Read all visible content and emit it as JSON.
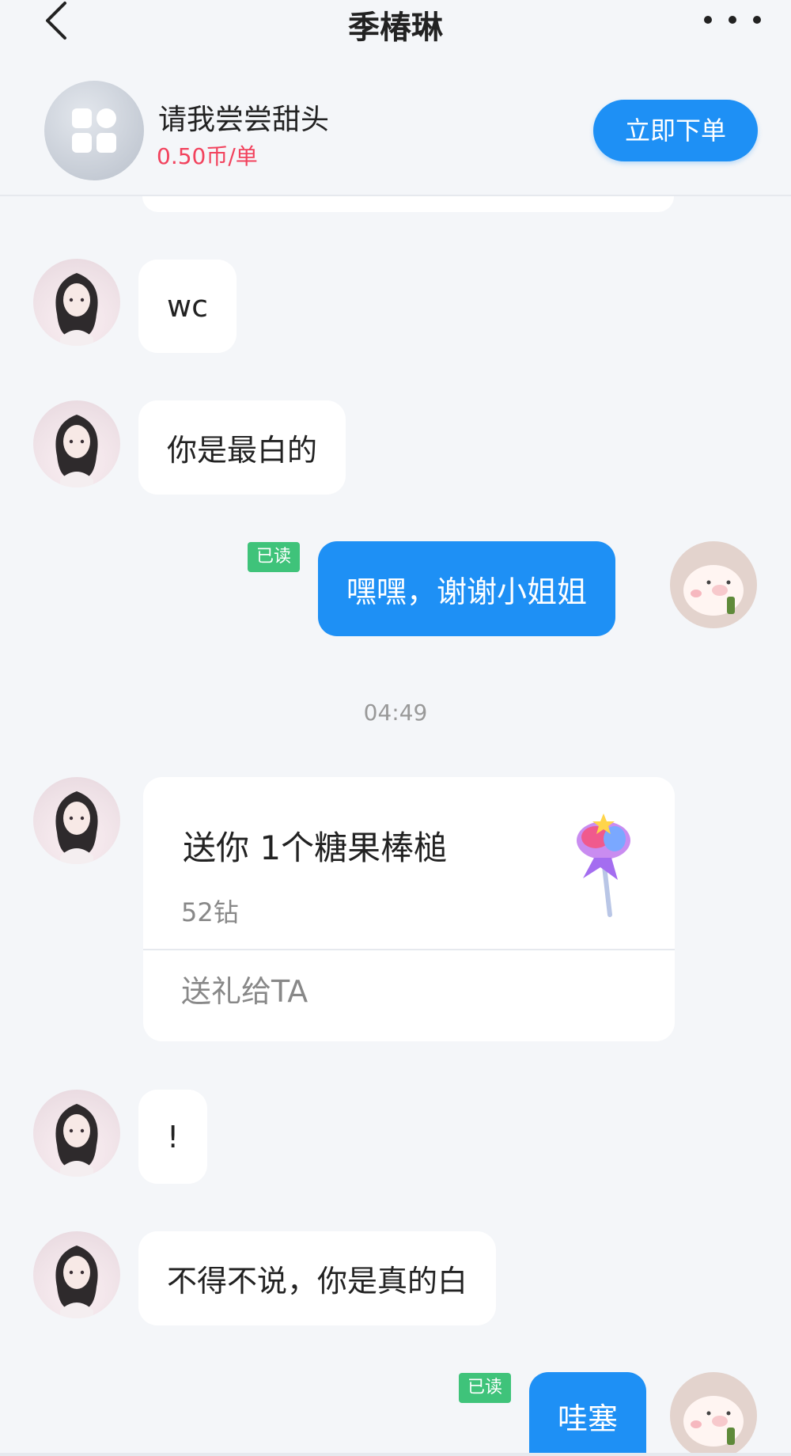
{
  "header": {
    "title": "季椿琳"
  },
  "order": {
    "name": "请我尝尝甜头",
    "price": "0.50币/单",
    "button_label": "立即下单"
  },
  "messages": [
    {
      "from": "other",
      "text": "wc"
    },
    {
      "from": "other",
      "text": "你是最白的"
    },
    {
      "from": "me",
      "text": "嘿嘿，谢谢小姐姐",
      "read_badge": "已读"
    },
    {
      "from": "other",
      "text": "!"
    },
    {
      "from": "other",
      "text": "不得不说，你是真的白"
    },
    {
      "from": "me",
      "text": "哇塞",
      "read_badge": "已读"
    }
  ],
  "timestamp": "04:49",
  "gift": {
    "title": "送你 1个糖果棒槌",
    "price": "52钻",
    "action_label": "送礼给TA",
    "icon": "candy-wand-icon"
  },
  "colors": {
    "accent": "#1e90f5",
    "price_red": "#f2425d",
    "read_green": "#3fc37a",
    "background": "#f4f6f9"
  }
}
